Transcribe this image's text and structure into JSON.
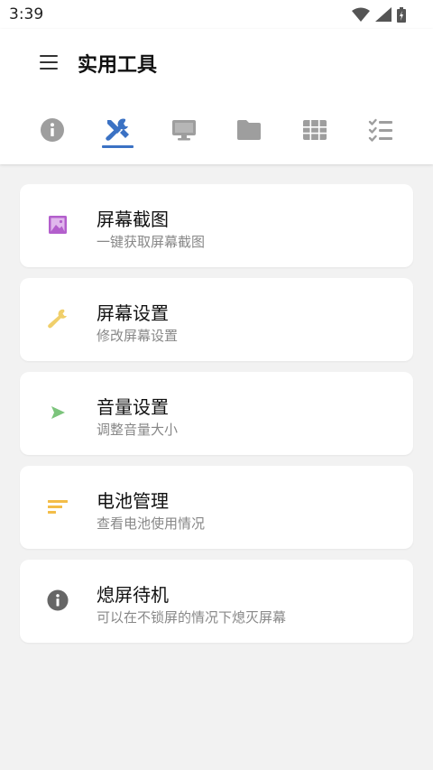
{
  "status_bar": {
    "time": "3:39"
  },
  "app_bar": {
    "title": "实用工具"
  },
  "tabs": [
    {
      "icon": "info-icon",
      "selected": false
    },
    {
      "icon": "tools-icon",
      "selected": true
    },
    {
      "icon": "monitor-icon",
      "selected": false
    },
    {
      "icon": "folder-icon",
      "selected": false
    },
    {
      "icon": "grid-icon",
      "selected": false
    },
    {
      "icon": "checklist-icon",
      "selected": false
    }
  ],
  "colors": {
    "accent": "#3b72c4",
    "tab_inactive": "#9e9e9e"
  },
  "cards": [
    {
      "title": "屏幕截图",
      "subtitle": "一键获取屏幕截图",
      "icon": "image-icon",
      "icon_color": "#b35fcc"
    },
    {
      "title": "屏幕设置",
      "subtitle": "修改屏幕设置",
      "icon": "wrench-icon",
      "icon_color": "#f0cf6b"
    },
    {
      "title": "音量设置",
      "subtitle": "调整音量大小",
      "icon": "play-icon",
      "icon_color": "#7cc47c"
    },
    {
      "title": "电池管理",
      "subtitle": "查看电池使用情况",
      "icon": "sort-lines-icon",
      "icon_color": "#f3bd48"
    },
    {
      "title": "熄屏待机",
      "subtitle": "可以在不锁屏的情况下熄灭屏幕",
      "icon": "info-circle-icon",
      "icon_color": "#666666"
    }
  ]
}
